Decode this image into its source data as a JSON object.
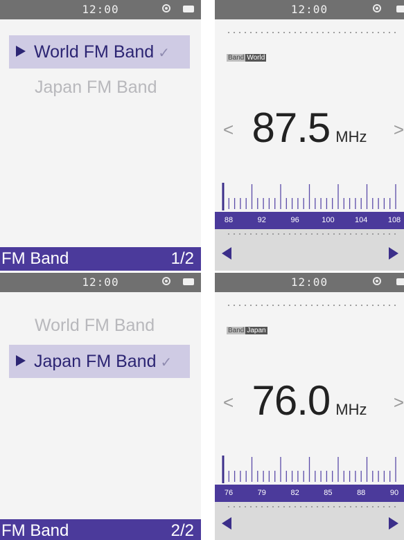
{
  "status": {
    "time": "12:00"
  },
  "menu_screens": [
    {
      "items": [
        {
          "label": "World FM Band",
          "selected": true,
          "check": "✓"
        },
        {
          "label": "Japan FM Band",
          "selected": false
        }
      ],
      "footer_title": "FM Band",
      "footer_page": "1/2"
    },
    {
      "items": [
        {
          "label": "World FM Band",
          "selected": false
        },
        {
          "label": "Japan FM Band",
          "selected": true,
          "check": "✓"
        }
      ],
      "footer_title": "FM Band",
      "footer_page": "2/2"
    }
  ],
  "radio_screens": [
    {
      "band_key": "Band",
      "band_value": "World",
      "frequency": "87.5",
      "unit": "MHz",
      "prev_chevron": "<",
      "next_chevron": ">",
      "scale_labels": [
        "88",
        "92",
        "96",
        "100",
        "104",
        "108"
      ],
      "scale_min": 87.5,
      "scale_max": 108,
      "current": 87.5
    },
    {
      "band_key": "Band",
      "band_value": "Japan",
      "frequency": "76.0",
      "unit": "MHz",
      "prev_chevron": "<",
      "next_chevron": ">",
      "scale_labels": [
        "76",
        "79",
        "82",
        "85",
        "88",
        "90"
      ],
      "scale_min": 76,
      "scale_max": 90,
      "current": 76
    }
  ],
  "colors": {
    "accent": "#4b3a9b",
    "selection_bg": "#cfcbe4",
    "statusbar": "#707070"
  }
}
